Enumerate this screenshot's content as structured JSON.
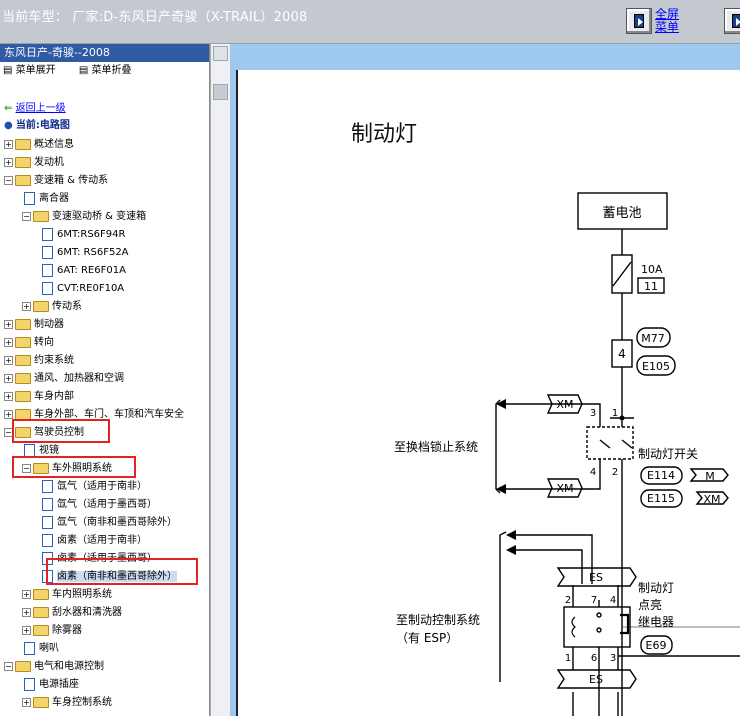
{
  "topbar": {
    "title": "当前车型：  厂家:D-东风日产奇骏（X-TRAIL）2008",
    "link_fullscreen": "全屏",
    "link_menu": "菜单"
  },
  "sidebar": {
    "header": "东风日产-奇骏--2008",
    "expand": "菜单展开",
    "collapse": "菜单折叠",
    "back": "返回上一级",
    "current": "当前:电路图",
    "items": [
      {
        "label": "概述信息",
        "type": "folder",
        "pm": "+"
      },
      {
        "label": "发动机",
        "type": "folder",
        "pm": "+"
      },
      {
        "label": "变速箱 & 传动系",
        "type": "folder",
        "pm": "-"
      },
      {
        "label": "离合器",
        "type": "doc"
      },
      {
        "label": "变速驱动桥 & 变速箱",
        "type": "folder",
        "pm": "-"
      },
      {
        "label": "6MT:RS6F94R",
        "type": "doc"
      },
      {
        "label": "6MT: RS6F52A",
        "type": "doc"
      },
      {
        "label": "6AT: RE6F01A",
        "type": "doc"
      },
      {
        "label": "CVT:RE0F10A",
        "type": "doc"
      },
      {
        "label": "传动系",
        "type": "folder",
        "pm": "+"
      },
      {
        "label": "制动器",
        "type": "folder",
        "pm": "+"
      },
      {
        "label": "转向",
        "type": "folder",
        "pm": "+"
      },
      {
        "label": "约束系统",
        "type": "folder",
        "pm": "+"
      },
      {
        "label": "通风、加热器和空调",
        "type": "folder",
        "pm": "+"
      },
      {
        "label": "车身内部",
        "type": "folder",
        "pm": "+"
      },
      {
        "label": "车身外部、车门、车顶和汽车安全",
        "type": "folder",
        "pm": "+"
      },
      {
        "label": "驾驶员控制",
        "type": "folder",
        "pm": "-"
      },
      {
        "label": "视镜",
        "type": "doc"
      },
      {
        "label": "车外照明系统",
        "type": "folder",
        "pm": "-"
      },
      {
        "label": "氙气（适用于南非）",
        "type": "doc"
      },
      {
        "label": "氙气（适用于墨西哥）",
        "type": "doc"
      },
      {
        "label": "氙气（南非和墨西哥除外）",
        "type": "doc"
      },
      {
        "label": "卤素（适用于南非）",
        "type": "doc"
      },
      {
        "label": "卤素（适用于墨西哥）",
        "type": "doc"
      },
      {
        "label": "卤素（南非和墨西哥除外）",
        "type": "doc"
      },
      {
        "label": "车内照明系统",
        "type": "folder",
        "pm": "+"
      },
      {
        "label": "刮水器和清洗器",
        "type": "folder",
        "pm": "+"
      },
      {
        "label": "除雾器",
        "type": "folder",
        "pm": "+"
      },
      {
        "label": "喇叭",
        "type": "doc"
      },
      {
        "label": "电气和电源控制",
        "type": "folder",
        "pm": "-"
      },
      {
        "label": "电源插座",
        "type": "doc"
      },
      {
        "label": "车身控制系统",
        "type": "folder",
        "pm": "+"
      }
    ]
  },
  "diagram": {
    "title": "制动灯",
    "battery": "蓄电池",
    "fuse_amp": "10A",
    "fuse_no": "11",
    "conn_m77": "M77",
    "conn_e105": "E105",
    "pin4": "4",
    "xm": "XM",
    "sw_pin1": "1",
    "sw_pin2": "2",
    "sw_pin3": "3",
    "sw_pin4": "4",
    "switch_name": "制动灯开关",
    "e114": "E114",
    "m": "M",
    "e115": "E115",
    "to_shift_lock": "至换档锁止系统",
    "es": "ES",
    "to_brake_ctrl": "至制动控制系统",
    "with_esp": "（有 ESP）",
    "relay_line1": "制动灯",
    "relay_line2": "点亮",
    "relay_line3": "继电器",
    "e69": "E69",
    "r2": "2",
    "r7": "7",
    "r4": "4",
    "r1": "1",
    "r6": "6",
    "r3": "3"
  }
}
